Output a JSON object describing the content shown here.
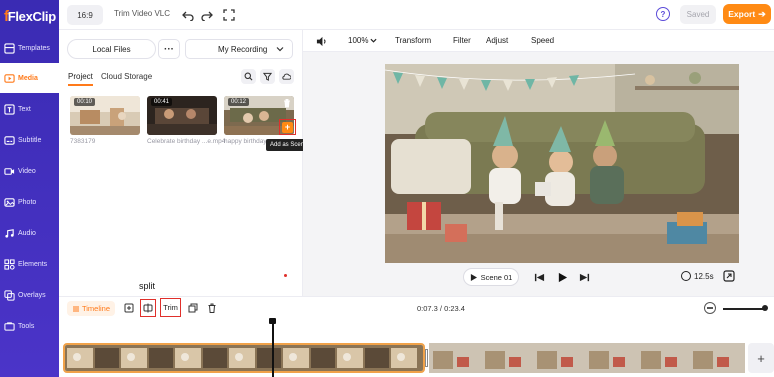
{
  "brand": {
    "logo_text": "FlexClip"
  },
  "sidebar": {
    "items": [
      {
        "label": "Templates",
        "icon": "templates-icon"
      },
      {
        "label": "Media",
        "icon": "media-icon",
        "active": true
      },
      {
        "label": "Text",
        "icon": "text-icon"
      },
      {
        "label": "Subtitle",
        "icon": "subtitle-icon"
      },
      {
        "label": "Video",
        "icon": "video-icon"
      },
      {
        "label": "Photo",
        "icon": "photo-icon"
      },
      {
        "label": "Audio",
        "icon": "audio-icon"
      },
      {
        "label": "Elements",
        "icon": "elements-icon"
      },
      {
        "label": "Overlays",
        "icon": "overlays-icon"
      },
      {
        "label": "Tools",
        "icon": "tools-icon"
      }
    ]
  },
  "topbar": {
    "ratio": "16:9",
    "project_title": "Trim Video VLC",
    "help": "?",
    "saved": "Saved",
    "export": "Export"
  },
  "media_panel": {
    "local_files": "Local Files",
    "more": "···",
    "recording": "My Recording",
    "tabs": [
      "Project",
      "Cloud Storage"
    ],
    "items": [
      {
        "duration": "00:10",
        "caption": "7383179"
      },
      {
        "duration": "00:41",
        "caption": "Celebrate birthday ...e.mp4"
      },
      {
        "duration": "00:12",
        "caption": "happy birthday"
      }
    ],
    "tooltip": "Add as Scene"
  },
  "preview_toolbar": {
    "zoom": "100%",
    "items": [
      "Transform",
      "Filter",
      "Adjust",
      "Speed"
    ]
  },
  "player": {
    "scene_label": "Scene 01",
    "duration": "12.5s"
  },
  "annotation": {
    "split_label": "split"
  },
  "timeline": {
    "label": "Timeline",
    "trim_label": "Trim",
    "time_readout": "0:07.3 / 0:23.4",
    "add_clip": "+"
  },
  "colors": {
    "accent": "#ff7a1a",
    "sidebar": "#4033bd",
    "highlight": "#e0302b",
    "clip_border": "#f0a24a"
  }
}
